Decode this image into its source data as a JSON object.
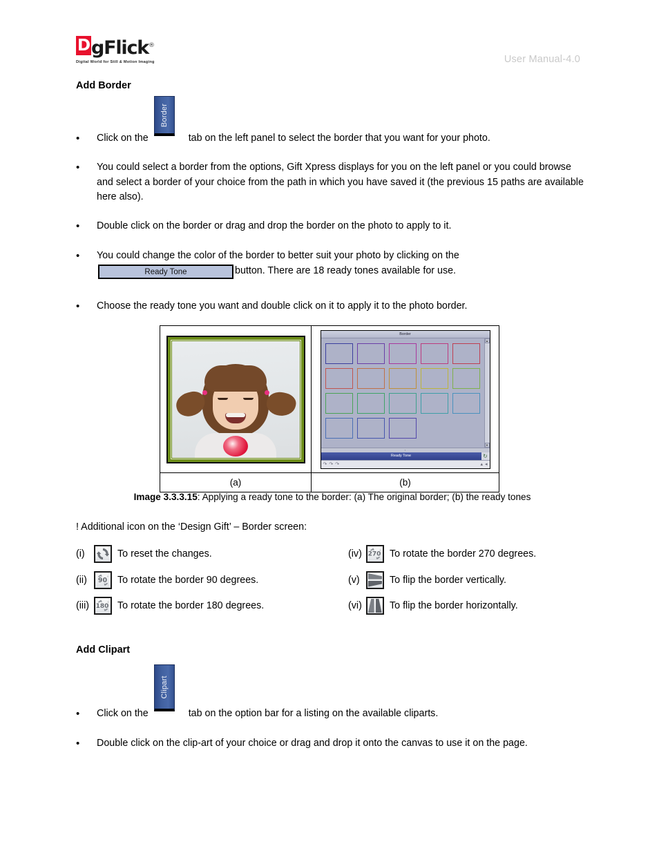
{
  "header": {
    "logo_d": "D",
    "logo_rest": "gFlick",
    "logo_registered": "®",
    "logo_tagline": "Digital World for Still & Motion Imaging",
    "manual_label": "User Manual-4.0"
  },
  "sections": {
    "add_border_heading": "Add Border",
    "add_clipart_heading": "Add Clipart"
  },
  "tabs": {
    "border_label": "Border",
    "clipart_label": "Clipart"
  },
  "bullets": {
    "b1_pre": "Click on the",
    "b1_post": "tab on the left panel to select the border that you want for your photo.",
    "b2": "You could select a border from the options, Gift Xpress displays for you on the left panel or you could browse and select a border of your choice from the path in which you have saved it (the previous 15 paths are available here also).",
    "b3": "Double click on the border or drag and drop the border on the photo to apply to it.",
    "b4_pre": "You could change the color of the border to better suit your photo by clicking on the",
    "b4_post": "button. There are 18 ready tones available for use.",
    "b5": "Choose the ready tone you want and double click on it to apply it to the photo border.",
    "c1_pre": "Click on the",
    "c1_post": "tab on the option bar for a listing on the available cliparts.",
    "c2": "Double click on the clip-art of your choice or drag and drop it onto the canvas to use it on the page.",
    "dot": "•"
  },
  "ready_tone_button": {
    "label": "Ready Tone"
  },
  "figure": {
    "label_a": "(a)",
    "label_b": "(b)",
    "caption_bold": "Image 3.3.3.15",
    "caption_rest": ": Applying a ready tone to the border: (a) The original border; (b) the ready tones",
    "panel_title": "Border",
    "panel_ready_tone": "Ready Tone",
    "panel_divider_mark": "▫",
    "scroll_up": "▲",
    "scroll_down": "▼",
    "swatch_colors": [
      "#3b3f9e",
      "#6a3fa8",
      "#a8399f",
      "#bd3c80",
      "#bf3f52",
      "#c0544f",
      "#c07048",
      "#c08f3a",
      "#bdb43a",
      "#7fb14b",
      "#4ba356",
      "#3fa467",
      "#3fa18c",
      "#3f9fa8",
      "#4a92bd",
      "#4a6fb5",
      "#4656ad",
      "#5247ab"
    ],
    "swatch_count": 18,
    "panel_bg": "#aeb2c8",
    "ready_tone_bar_color": "#3a4a96",
    "border_color_photo": "#6f8f1b"
  },
  "note": {
    "text": "! Additional icon on the ‘Design Gift’ – Border screen:"
  },
  "icon_list_left": [
    {
      "roman": "(i)",
      "icon": "reset-icon",
      "label": "To reset the changes.",
      "glyph": ""
    },
    {
      "roman": "(ii)",
      "icon": "rotate-90-icon",
      "label": "To rotate the border 90 degrees.",
      "glyph": "90"
    },
    {
      "roman": "(iii)",
      "icon": "rotate-180-icon",
      "label": "To rotate the border 180 degrees.",
      "glyph": "180"
    }
  ],
  "icon_list_right": [
    {
      "roman": "(iv)",
      "icon": "rotate-270-icon",
      "label": "To rotate the border 270 degrees.",
      "glyph": "270"
    },
    {
      "roman": "(v)",
      "icon": "flip-vertical-icon",
      "label": "To flip the border vertically.",
      "glyph": ""
    },
    {
      "roman": "(vi)",
      "icon": "flip-horizontal-icon",
      "label": "To flip the border horizontally.",
      "glyph": ""
    }
  ],
  "colors": {
    "tab_blue": "#41609f",
    "logo_red": "#e8112d",
    "manual_gray": "#c9c9c9",
    "ready_tone_fill": "#b8c3dc"
  }
}
